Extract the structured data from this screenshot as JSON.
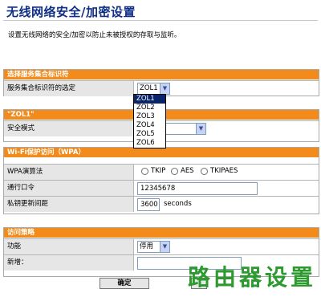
{
  "page": {
    "title": "无线网络安全/加密设置",
    "description": "设置无线网络的安全/加密以防止未被授权的存取与监听。"
  },
  "ssid_section": {
    "header": "选择服务集合标识符",
    "label": "服务集合标识符的选定",
    "selected": "ZOL1",
    "options": [
      "ZOL1",
      "ZOL2",
      "ZOL3",
      "ZOL4",
      "ZOL5",
      "ZOL6"
    ]
  },
  "zol_section": {
    "header": "\"ZOL1\"",
    "security_mode_label": "安全模式",
    "security_mode_value": ""
  },
  "wpa_section": {
    "header": "Wi-Fi保护访问（WPA）",
    "algorithm_label": "WPA演算法",
    "algorithms": [
      "TKIP",
      "AES",
      "TKIPAES"
    ],
    "passphrase_label": "通行口令",
    "passphrase_value": "12345678",
    "rekey_label": "私钥更新间距",
    "rekey_value": "3600",
    "rekey_unit": "seconds"
  },
  "policy_section": {
    "header": "访问策略",
    "function_label": "功能",
    "function_value": "停用",
    "add_label": "新增："
  },
  "buttons": {
    "confirm": "确定"
  },
  "watermark": "路由器设置"
}
